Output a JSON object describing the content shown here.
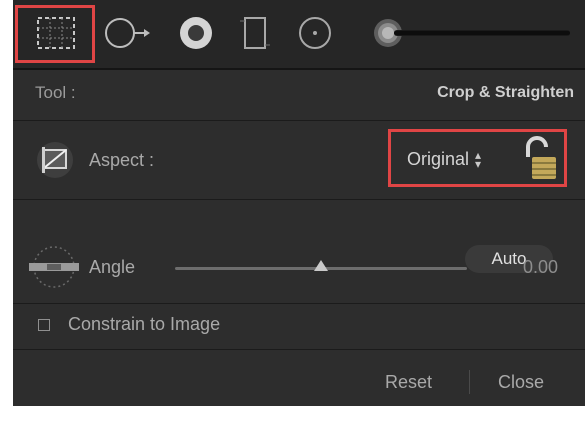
{
  "toolbar": {
    "tools": [
      {
        "name": "crop-overlay-tool",
        "icon": "crop-grid-icon",
        "selected": true
      },
      {
        "name": "spot-removal-tool",
        "icon": "circle-arrow-icon",
        "selected": false
      },
      {
        "name": "red-eye-tool",
        "icon": "eye-icon",
        "selected": false
      },
      {
        "name": "graduated-filter-tool",
        "icon": "graduated-filter-icon",
        "selected": false
      },
      {
        "name": "radial-filter-tool",
        "icon": "radial-filter-icon",
        "selected": false
      },
      {
        "name": "adjustment-brush-tool",
        "icon": "brush-icon",
        "selected": false
      }
    ]
  },
  "tool": {
    "label": "Tool :",
    "value": "Crop & Straighten"
  },
  "aspect": {
    "label": "Aspect :",
    "value": "Original",
    "lock_icon": "unlocked-padlock-icon"
  },
  "angle": {
    "label": "Angle",
    "value": "0.00",
    "auto_label": "Auto",
    "slider_fraction": 0.5
  },
  "constrain": {
    "label": "Constrain to Image",
    "checked": false
  },
  "footer": {
    "reset_label": "Reset",
    "close_label": "Close"
  },
  "colors": {
    "highlight": "#e04545",
    "panel_bg": "#2d2d2d",
    "toolbar_bg": "#262626"
  }
}
